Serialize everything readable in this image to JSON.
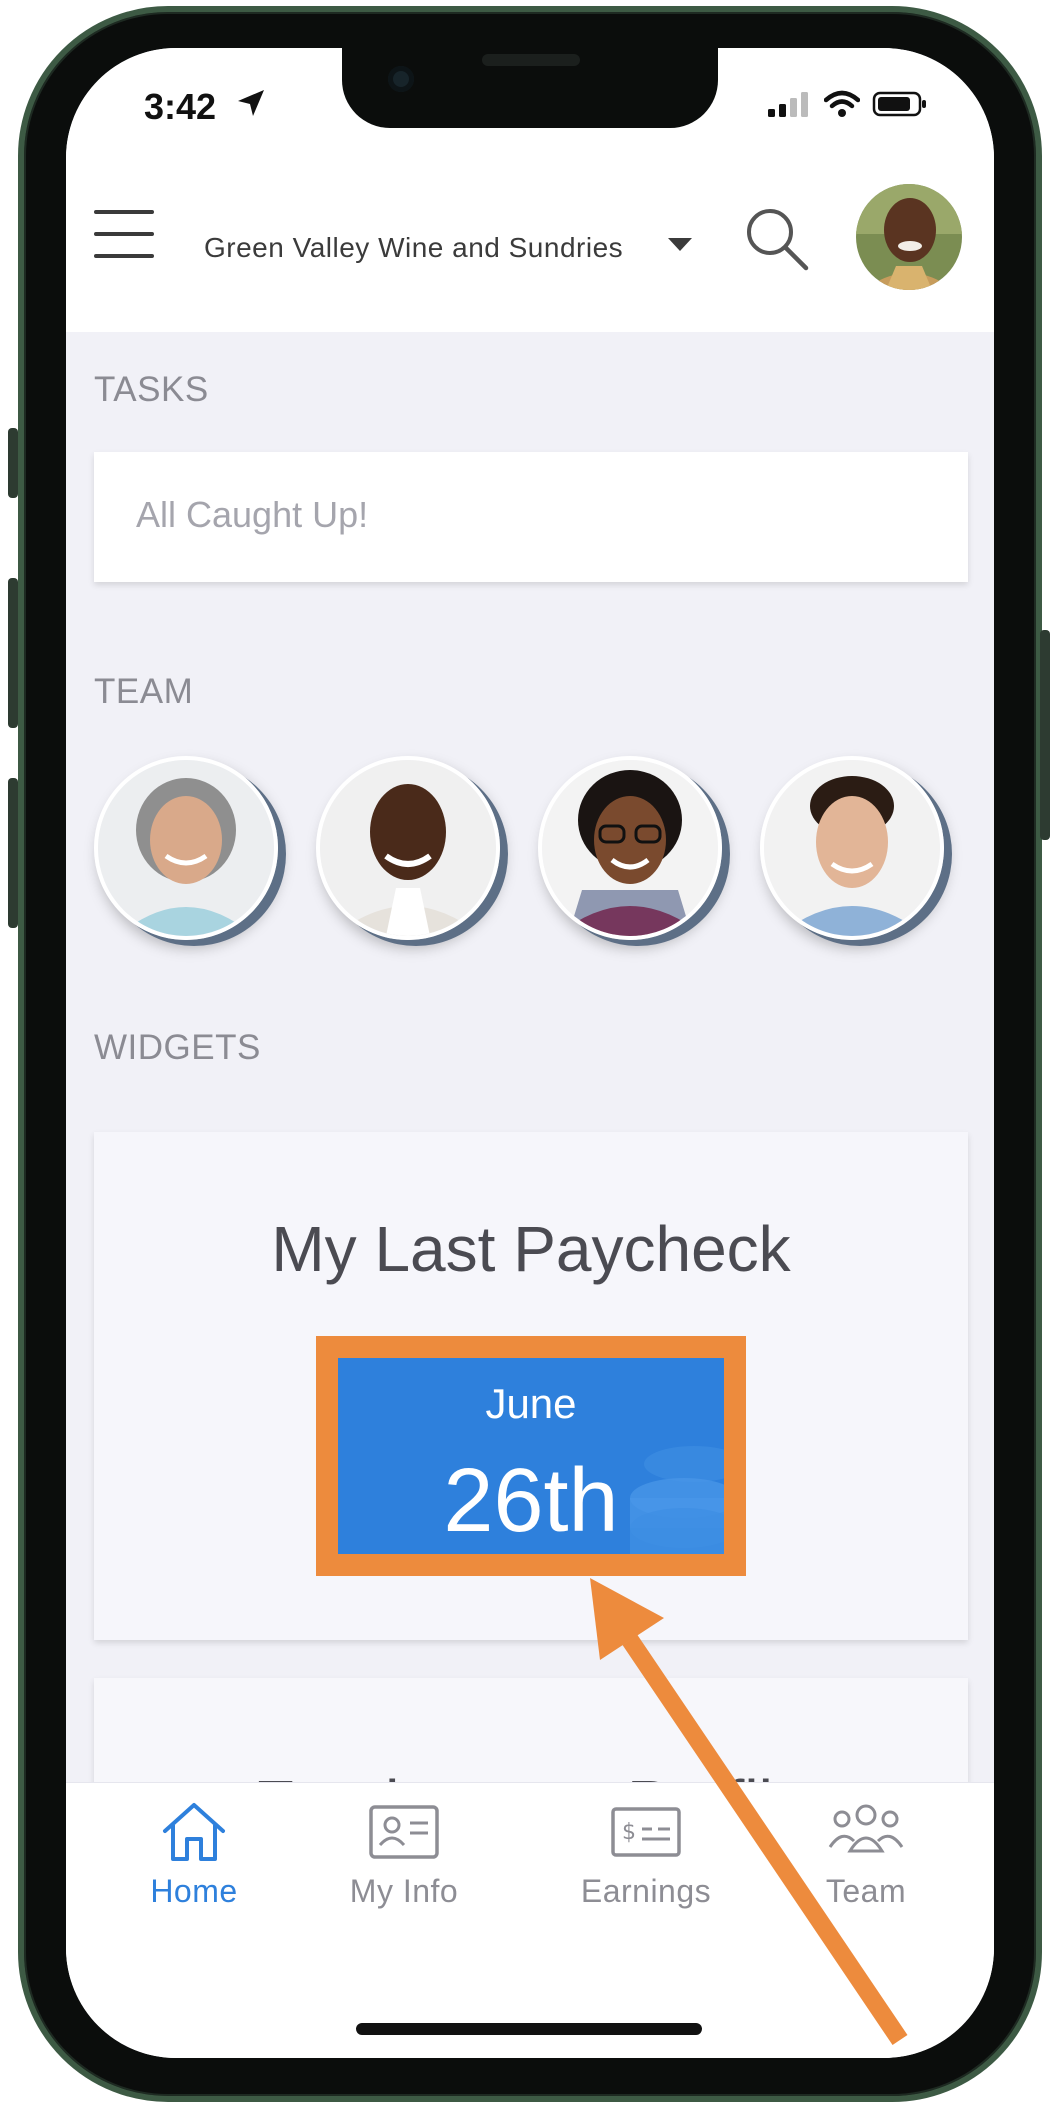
{
  "status_bar": {
    "time": "3:42"
  },
  "header": {
    "company": "Green Valley Wine and Sundries"
  },
  "tasks": {
    "label": "TASKS",
    "message": "All Caught Up!"
  },
  "team": {
    "label": "TEAM"
  },
  "widgets": {
    "label": "WIDGETS",
    "paycheck": {
      "title": "My Last Paycheck",
      "month": "June",
      "day": "26th"
    },
    "next_title": "Employment Profile"
  },
  "bottom_nav": {
    "items": [
      {
        "label": "Home",
        "icon": "home-icon"
      },
      {
        "label": "My Info",
        "icon": "id-card-icon"
      },
      {
        "label": "Earnings",
        "icon": "check-icon"
      },
      {
        "label": "Team",
        "icon": "people-icon"
      }
    ]
  },
  "colors": {
    "accent": "#2e80dc",
    "highlight": "#ed8b3d",
    "background": "#f1f1f7"
  }
}
